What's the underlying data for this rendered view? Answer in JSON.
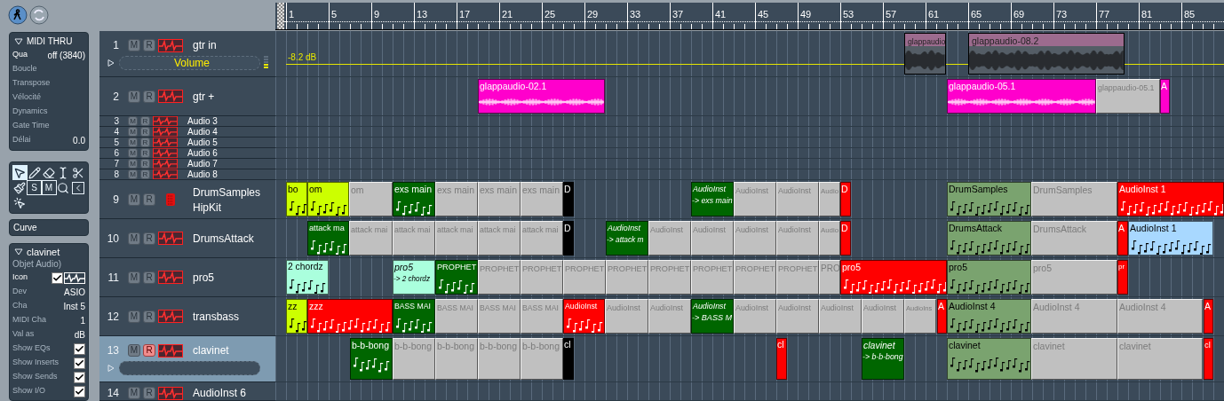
{
  "inspector": {
    "midi_thru": {
      "title": "MIDI THRU",
      "expanded": true,
      "params": [
        {
          "label": "Qua",
          "value": "off (3840)",
          "active": true
        },
        {
          "label": "Boucle",
          "active": false
        },
        {
          "label": "Transpose",
          "active": false
        },
        {
          "label": "Vélocité",
          "active": false
        },
        {
          "label": "Dynamics",
          "active": false
        },
        {
          "label": "Gate Time",
          "active": false
        },
        {
          "label": "Délai",
          "value": "0.0",
          "active": false
        }
      ]
    },
    "tools": [
      {
        "kind": "pointer",
        "selected": true
      },
      {
        "kind": "pencil",
        "selected": false
      },
      {
        "kind": "eraser",
        "selected": false
      },
      {
        "kind": "text",
        "selected": false
      },
      {
        "kind": "scissors",
        "selected": false
      },
      {
        "kind": "glue",
        "selected": false
      },
      {
        "kind": "solo",
        "label": "S",
        "selected": false
      },
      {
        "kind": "mute",
        "label": "M",
        "selected": false
      },
      {
        "kind": "zoom",
        "selected": false
      },
      {
        "kind": "crossfade",
        "selected": false
      },
      {
        "kind": "automation",
        "selected": false
      }
    ],
    "curve": {
      "label": "Curve"
    },
    "object": {
      "title": "clavinet",
      "expanded": true,
      "subtitle": "Objet Audio)",
      "rows": [
        {
          "kind": "icon",
          "label": "Icon",
          "checked": true
        },
        {
          "kind": "value",
          "label": "Dev",
          "value": "ASIO"
        },
        {
          "kind": "value",
          "label": "Cha",
          "value": "Inst 5"
        },
        {
          "kind": "value",
          "label": "MIDI Cha",
          "value": "1"
        },
        {
          "kind": "value",
          "label": "Val as",
          "value": "dB"
        },
        {
          "kind": "checkbox",
          "label": "Show EQs",
          "checked": true
        },
        {
          "kind": "checkbox",
          "label": "Show Inserts",
          "checked": true
        },
        {
          "kind": "checkbox",
          "label": "Show Sends",
          "checked": true
        },
        {
          "kind": "checkbox",
          "label": "Show I/O",
          "checked": true
        }
      ]
    }
  },
  "ruler": {
    "bars": [
      "1",
      "5",
      "9",
      "13",
      "17",
      "21",
      "25",
      "29",
      "33",
      "37",
      "41",
      "45",
      "49",
      "53",
      "57",
      "61",
      "65",
      "69",
      "73",
      "77",
      "81",
      "85"
    ]
  },
  "tracks": [
    {
      "number": "1",
      "name": "gtr in",
      "kind": "audio",
      "mute_button": "M",
      "record_button": "R",
      "record": false,
      "selected": false,
      "expanded": true,
      "automation": "Volume",
      "automation_value": "-8.2 dB",
      "regions": [
        {
          "name": "glappaudio",
          "kind": "take",
          "color": "#9c6b8e"
        },
        {
          "name": "glappaudio-08.2",
          "kind": "take",
          "color": "#9c6b8e"
        }
      ]
    },
    {
      "number": "2",
      "name": "gtr +",
      "kind": "audio",
      "mute_button": "M",
      "record_button": "R",
      "record": false,
      "selected": false,
      "expanded": false,
      "regions": [
        {
          "name": "glappaudio-02.1",
          "kind": "audio",
          "color": "#ff00cc"
        },
        {
          "name": "glappaudio-05.1",
          "kind": "audio",
          "color": "#ff00cc"
        },
        {
          "name": "glappaudio-05.1",
          "kind": "alias",
          "color": "#c0c0c0"
        },
        {
          "name": "A",
          "kind": "audio",
          "color": "#ff00cc"
        }
      ]
    },
    {
      "number": "3",
      "name": "Audio 3",
      "kind": "audio",
      "mute_button": "M",
      "record_button": "R",
      "record": false,
      "selected": false,
      "expanded": false
    },
    {
      "number": "4",
      "name": "Audio 4",
      "kind": "audio",
      "mute_button": "M",
      "record_button": "R",
      "record": false,
      "selected": false,
      "expanded": false
    },
    {
      "number": "5",
      "name": "Audio 5",
      "kind": "audio",
      "mute_button": "M",
      "record_button": "R",
      "record": false,
      "selected": false,
      "expanded": false
    },
    {
      "number": "6",
      "name": "Audio 6",
      "kind": "audio",
      "mute_button": "M",
      "record_button": "R",
      "record": false,
      "selected": false,
      "expanded": false
    },
    {
      "number": "7",
      "name": "Audio 7",
      "kind": "audio",
      "mute_button": "M",
      "record_button": "R",
      "record": false,
      "selected": false,
      "expanded": false
    },
    {
      "number": "8",
      "name": "Audio 8",
      "kind": "audio",
      "mute_button": "M",
      "record_button": "R",
      "record": false,
      "selected": false,
      "expanded": false
    },
    {
      "number": "9",
      "name": "DrumSamples",
      "subname": "HipKit",
      "kind": "drum",
      "mute_button": "M",
      "record_button": "R",
      "record": false,
      "selected": false,
      "expanded": false,
      "regions": [
        {
          "name": "bo",
          "kind": "midi",
          "color": "#ccff00"
        },
        {
          "name": "om",
          "kind": "midi",
          "color": "#ccff00"
        },
        {
          "name": "om",
          "kind": "alias",
          "color": "#c0c0c0"
        },
        {
          "name": "exs main",
          "kind": "midi",
          "color": "#006600"
        },
        {
          "name": "exs main",
          "kind": "alias",
          "color": "#c0c0c0"
        },
        {
          "name": "exs main",
          "kind": "alias",
          "color": "#c0c0c0"
        },
        {
          "name": "exs main",
          "kind": "alias",
          "color": "#c0c0c0"
        },
        {
          "name": "D",
          "kind": "midi",
          "color": "#000000"
        },
        {
          "name": "AudioInst",
          "subtitle": "-> exs main",
          "kind": "midi",
          "color": "#006600"
        },
        {
          "name": "AudioInst",
          "kind": "alias",
          "color": "#c0c0c0"
        },
        {
          "name": "AudioInst",
          "kind": "alias",
          "color": "#c0c0c0"
        },
        {
          "name": "Audio",
          "kind": "alias",
          "color": "#c0c0c0"
        },
        {
          "name": "D",
          "kind": "midi",
          "color": "#ff0000"
        },
        {
          "name": "DrumSamples",
          "kind": "midi",
          "color": "#7aa36f"
        },
        {
          "name": "DrumSamples",
          "kind": "alias",
          "color": "#c0c0c0"
        },
        {
          "name": "AudioInst 1",
          "kind": "midi",
          "color": "#ff0000"
        }
      ]
    },
    {
      "number": "10",
      "name": "DrumsAttack",
      "kind": "audio",
      "mute_button": "M",
      "record_button": "R",
      "record": false,
      "selected": false,
      "expanded": false,
      "regions": [
        {
          "name": "attack ma",
          "kind": "midi",
          "color": "#006600"
        },
        {
          "name": "attack mai",
          "kind": "alias",
          "color": "#c0c0c0"
        },
        {
          "name": "attack mai",
          "kind": "alias",
          "color": "#c0c0c0"
        },
        {
          "name": "attack mai",
          "kind": "alias",
          "color": "#c0c0c0"
        },
        {
          "name": "attack mai",
          "kind": "alias",
          "color": "#c0c0c0"
        },
        {
          "name": "attack mai",
          "kind": "alias",
          "color": "#c0c0c0"
        },
        {
          "name": "D",
          "kind": "midi",
          "color": "#000000"
        },
        {
          "name": "AudioInst",
          "subtitle": "-> attack m",
          "kind": "midi",
          "color": "#006600"
        },
        {
          "name": "AudioInst",
          "kind": "alias",
          "color": "#c0c0c0"
        },
        {
          "name": "AudioInst",
          "kind": "alias",
          "color": "#c0c0c0"
        },
        {
          "name": "AudioInst",
          "kind": "alias",
          "color": "#c0c0c0"
        },
        {
          "name": "AudioInst",
          "kind": "alias",
          "color": "#c0c0c0"
        },
        {
          "name": "Audio",
          "kind": "alias",
          "color": "#c0c0c0"
        },
        {
          "name": "D",
          "kind": "midi",
          "color": "#ff0000"
        },
        {
          "name": "DrumsAttack",
          "kind": "midi",
          "color": "#7aa36f"
        },
        {
          "name": "DrumsAttack",
          "kind": "alias",
          "color": "#c0c0c0"
        },
        {
          "name": "A",
          "kind": "midi",
          "color": "#ff0000"
        },
        {
          "name": "AudioInst 1",
          "kind": "midi",
          "color": "#a8d8ff"
        }
      ]
    },
    {
      "number": "11",
      "name": "pro5",
      "kind": "audio",
      "mute_button": "M",
      "record_button": "R",
      "record": false,
      "selected": false,
      "expanded": false,
      "regions": [
        {
          "name": "2 chordz",
          "kind": "midi",
          "color": "#aaffdd"
        },
        {
          "name": "pro5",
          "subtitle": "-> 2 chordz",
          "kind": "midi",
          "color": "#aaffdd"
        },
        {
          "name": "PROPHET",
          "kind": "midi",
          "color": "#006600"
        },
        {
          "name": "PROPHET",
          "kind": "alias",
          "color": "#c0c0c0"
        },
        {
          "name": "PROPHET",
          "kind": "alias",
          "color": "#c0c0c0"
        },
        {
          "name": "PROPHET",
          "kind": "alias",
          "color": "#c0c0c0"
        },
        {
          "name": "PROPHET",
          "kind": "alias",
          "color": "#c0c0c0"
        },
        {
          "name": "PROPHET",
          "kind": "alias",
          "color": "#c0c0c0"
        },
        {
          "name": "PROPHET",
          "kind": "alias",
          "color": "#c0c0c0"
        },
        {
          "name": "PROPHET",
          "kind": "alias",
          "color": "#c0c0c0"
        },
        {
          "name": "PROPHET",
          "kind": "alias",
          "color": "#c0c0c0"
        },
        {
          "name": "PRO",
          "kind": "alias",
          "color": "#c0c0c0"
        },
        {
          "name": "pro5",
          "kind": "midi",
          "color": "#ff0000"
        },
        {
          "name": "pro5",
          "kind": "midi",
          "color": "#7aa36f"
        },
        {
          "name": "pro5",
          "kind": "alias",
          "color": "#c0c0c0"
        },
        {
          "name": "pr",
          "kind": "midi",
          "color": "#ff0000"
        }
      ]
    },
    {
      "number": "12",
      "name": "transbass",
      "kind": "audio",
      "mute_button": "M",
      "record_button": "R",
      "record": false,
      "selected": false,
      "expanded": false,
      "regions": [
        {
          "name": "zz",
          "kind": "midi",
          "color": "#ccff00"
        },
        {
          "name": "zzz",
          "kind": "midi",
          "color": "#ff0000"
        },
        {
          "name": "BASS MAI",
          "kind": "midi",
          "color": "#006600"
        },
        {
          "name": "BASS MAI",
          "kind": "alias",
          "color": "#c0c0c0"
        },
        {
          "name": "BASS MAI",
          "kind": "alias",
          "color": "#c0c0c0"
        },
        {
          "name": "BASS MAI",
          "kind": "alias",
          "color": "#c0c0c0"
        },
        {
          "name": "AudioInst",
          "kind": "midi",
          "color": "#ff0000"
        },
        {
          "name": "AudioInst",
          "kind": "alias",
          "color": "#c0c0c0"
        },
        {
          "name": "AudioInst",
          "kind": "alias",
          "color": "#c0c0c0"
        },
        {
          "name": "AudioInst",
          "subtitle": "-> BASS M",
          "kind": "midi",
          "color": "#006600"
        },
        {
          "name": "AudioInst",
          "kind": "alias",
          "color": "#c0c0c0"
        },
        {
          "name": "AudioInst",
          "kind": "alias",
          "color": "#c0c0c0"
        },
        {
          "name": "AudioInst",
          "kind": "alias",
          "color": "#c0c0c0"
        },
        {
          "name": "AudioInst",
          "kind": "alias",
          "color": "#c0c0c0"
        },
        {
          "name": "AudioIns",
          "kind": "alias",
          "color": "#c0c0c0"
        },
        {
          "name": "A",
          "kind": "midi",
          "color": "#ff0000"
        },
        {
          "name": "AudioInst 4",
          "kind": "midi",
          "color": "#7aa36f"
        },
        {
          "name": "AudioInst 4",
          "kind": "alias",
          "color": "#c0c0c0"
        },
        {
          "name": "AudioInst 4",
          "kind": "alias",
          "color": "#c0c0c0"
        },
        {
          "name": "A",
          "kind": "midi",
          "color": "#ff0000"
        }
      ]
    },
    {
      "number": "13",
      "name": "clavinet",
      "kind": "audio",
      "mute_button": "M",
      "record_button": "R",
      "record": true,
      "selected": true,
      "expanded": true,
      "regions": [
        {
          "name": "b-b-bong",
          "kind": "midi",
          "color": "#006600"
        },
        {
          "name": "b-b-bong",
          "kind": "alias",
          "color": "#c0c0c0"
        },
        {
          "name": "b-b-bong",
          "kind": "alias",
          "color": "#c0c0c0"
        },
        {
          "name": "b-b-bong",
          "kind": "alias",
          "color": "#c0c0c0"
        },
        {
          "name": "b-b-bong",
          "kind": "alias",
          "color": "#c0c0c0"
        },
        {
          "name": "cl",
          "kind": "midi",
          "color": "#000000"
        },
        {
          "name": "cl",
          "kind": "midi",
          "color": "#ff0000"
        },
        {
          "name": "clavinet",
          "subtitle": "-> b-b-bong",
          "kind": "midi",
          "color": "#006600"
        },
        {
          "name": "clavinet",
          "kind": "midi",
          "color": "#7aa36f"
        },
        {
          "name": "clavinet",
          "kind": "alias",
          "color": "#c0c0c0"
        },
        {
          "name": "clavinet",
          "kind": "alias",
          "color": "#c0c0c0"
        },
        {
          "name": "cl",
          "kind": "midi",
          "color": "#ff0000"
        }
      ]
    },
    {
      "number": "14",
      "name": "AudioInst 6",
      "kind": "audio",
      "mute_button": "M",
      "record_button": "R",
      "record": false,
      "selected": false
    }
  ]
}
